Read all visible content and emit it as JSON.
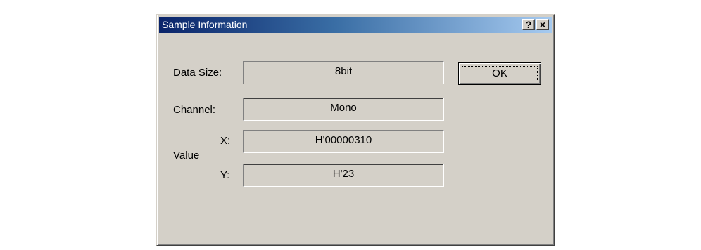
{
  "dialog": {
    "title": "Sample Information",
    "help_button": "?",
    "close_button": "×"
  },
  "fields": {
    "data_size": {
      "label": "Data Size:",
      "value": "8bit"
    },
    "channel": {
      "label": "Channel:",
      "value": "Mono"
    },
    "value_group_label": "Value",
    "x": {
      "label": "X:",
      "value": "H'00000310"
    },
    "y": {
      "label": "Y:",
      "value": "H'23"
    }
  },
  "buttons": {
    "ok_label": "OK"
  }
}
